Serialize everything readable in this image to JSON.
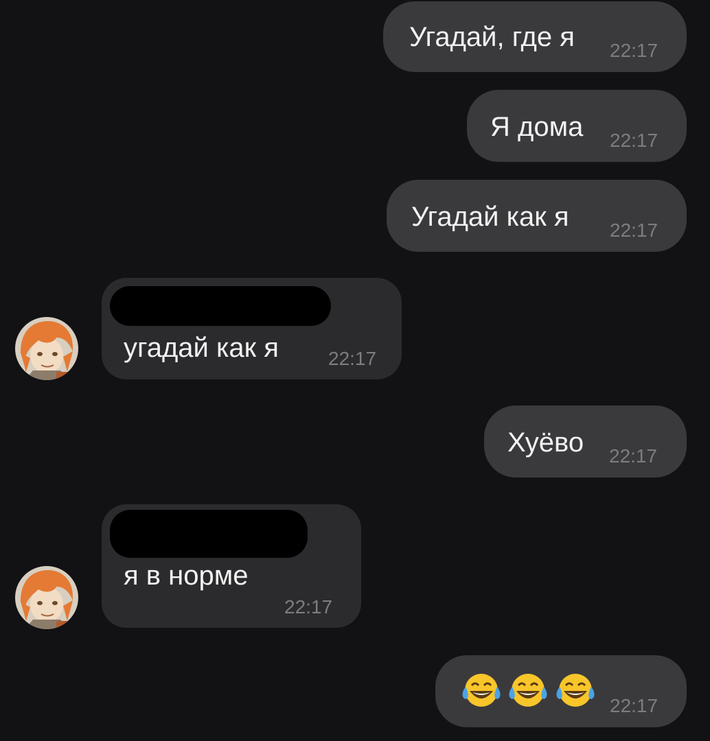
{
  "chat": {
    "messages": [
      {
        "direction": "outgoing",
        "text": "Угадай, где я",
        "time": "22:17"
      },
      {
        "direction": "outgoing",
        "text": "Я дома",
        "time": "22:17"
      },
      {
        "direction": "outgoing",
        "text": "Угадай как я",
        "time": "22:17"
      },
      {
        "direction": "incoming",
        "text": "угадай как я",
        "time": "22:17",
        "sender_name_redacted": true,
        "avatar_icon": "anime-avatar-icon"
      },
      {
        "direction": "outgoing",
        "text": "Хуёво",
        "time": "22:17"
      },
      {
        "direction": "incoming",
        "text": "я в норме",
        "time": "22:17",
        "sender_name_redacted": true,
        "avatar_icon": "anime-avatar-icon"
      },
      {
        "direction": "outgoing",
        "emoji": [
          "face-with-tears-of-joy",
          "face-with-tears-of-joy",
          "face-with-tears-of-joy"
        ],
        "time": "22:17"
      }
    ]
  },
  "colors": {
    "background": "#121113",
    "outgoing_bubble": "#3a3a3d",
    "incoming_bubble": "#2b2b2e",
    "message_text": "#f2f2f2",
    "timestamp": "#7d7d80",
    "redaction": "#000000"
  }
}
